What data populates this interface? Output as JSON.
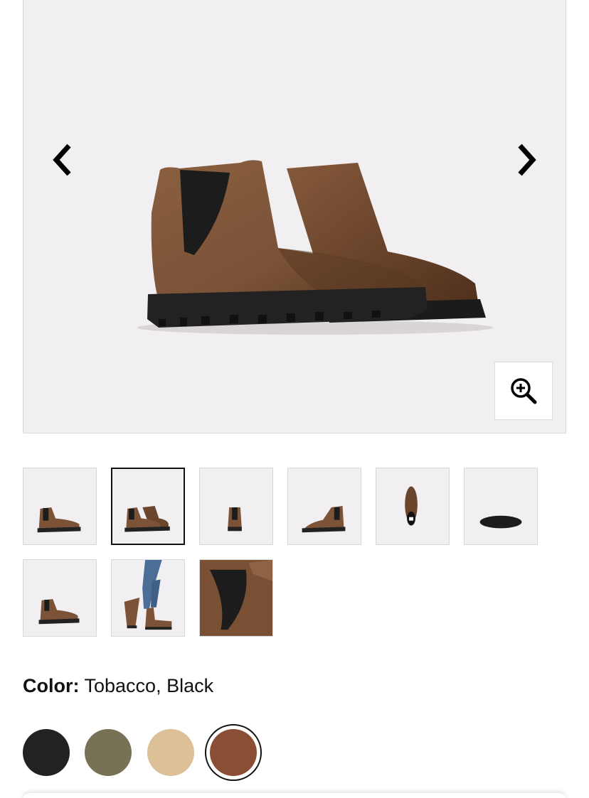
{
  "gallery": {
    "prev_icon": "chevron-left-icon",
    "next_icon": "chevron-right-icon",
    "zoom_icon": "zoom-in-icon",
    "background": "#f1eff1"
  },
  "thumbnails": [
    {
      "name": "side-view",
      "selected": false
    },
    {
      "name": "pair-angle-view",
      "selected": true
    },
    {
      "name": "back-view",
      "selected": false
    },
    {
      "name": "inside-view",
      "selected": false
    },
    {
      "name": "top-view",
      "selected": false
    },
    {
      "name": "sole-view",
      "selected": false
    },
    {
      "name": "three-quarter-view",
      "selected": false
    },
    {
      "name": "on-model-view",
      "selected": false
    },
    {
      "name": "detail-view",
      "selected": false
    }
  ],
  "color": {
    "label": "Color:",
    "value": "Tobacco, Black"
  },
  "swatches": [
    {
      "name": "black",
      "hex": "#222222",
      "selected": false
    },
    {
      "name": "olive",
      "hex": "#777256",
      "selected": false
    },
    {
      "name": "tan",
      "hex": "#dcc098",
      "selected": false
    },
    {
      "name": "tobacco",
      "hex": "#8a4e34",
      "selected": true
    }
  ]
}
